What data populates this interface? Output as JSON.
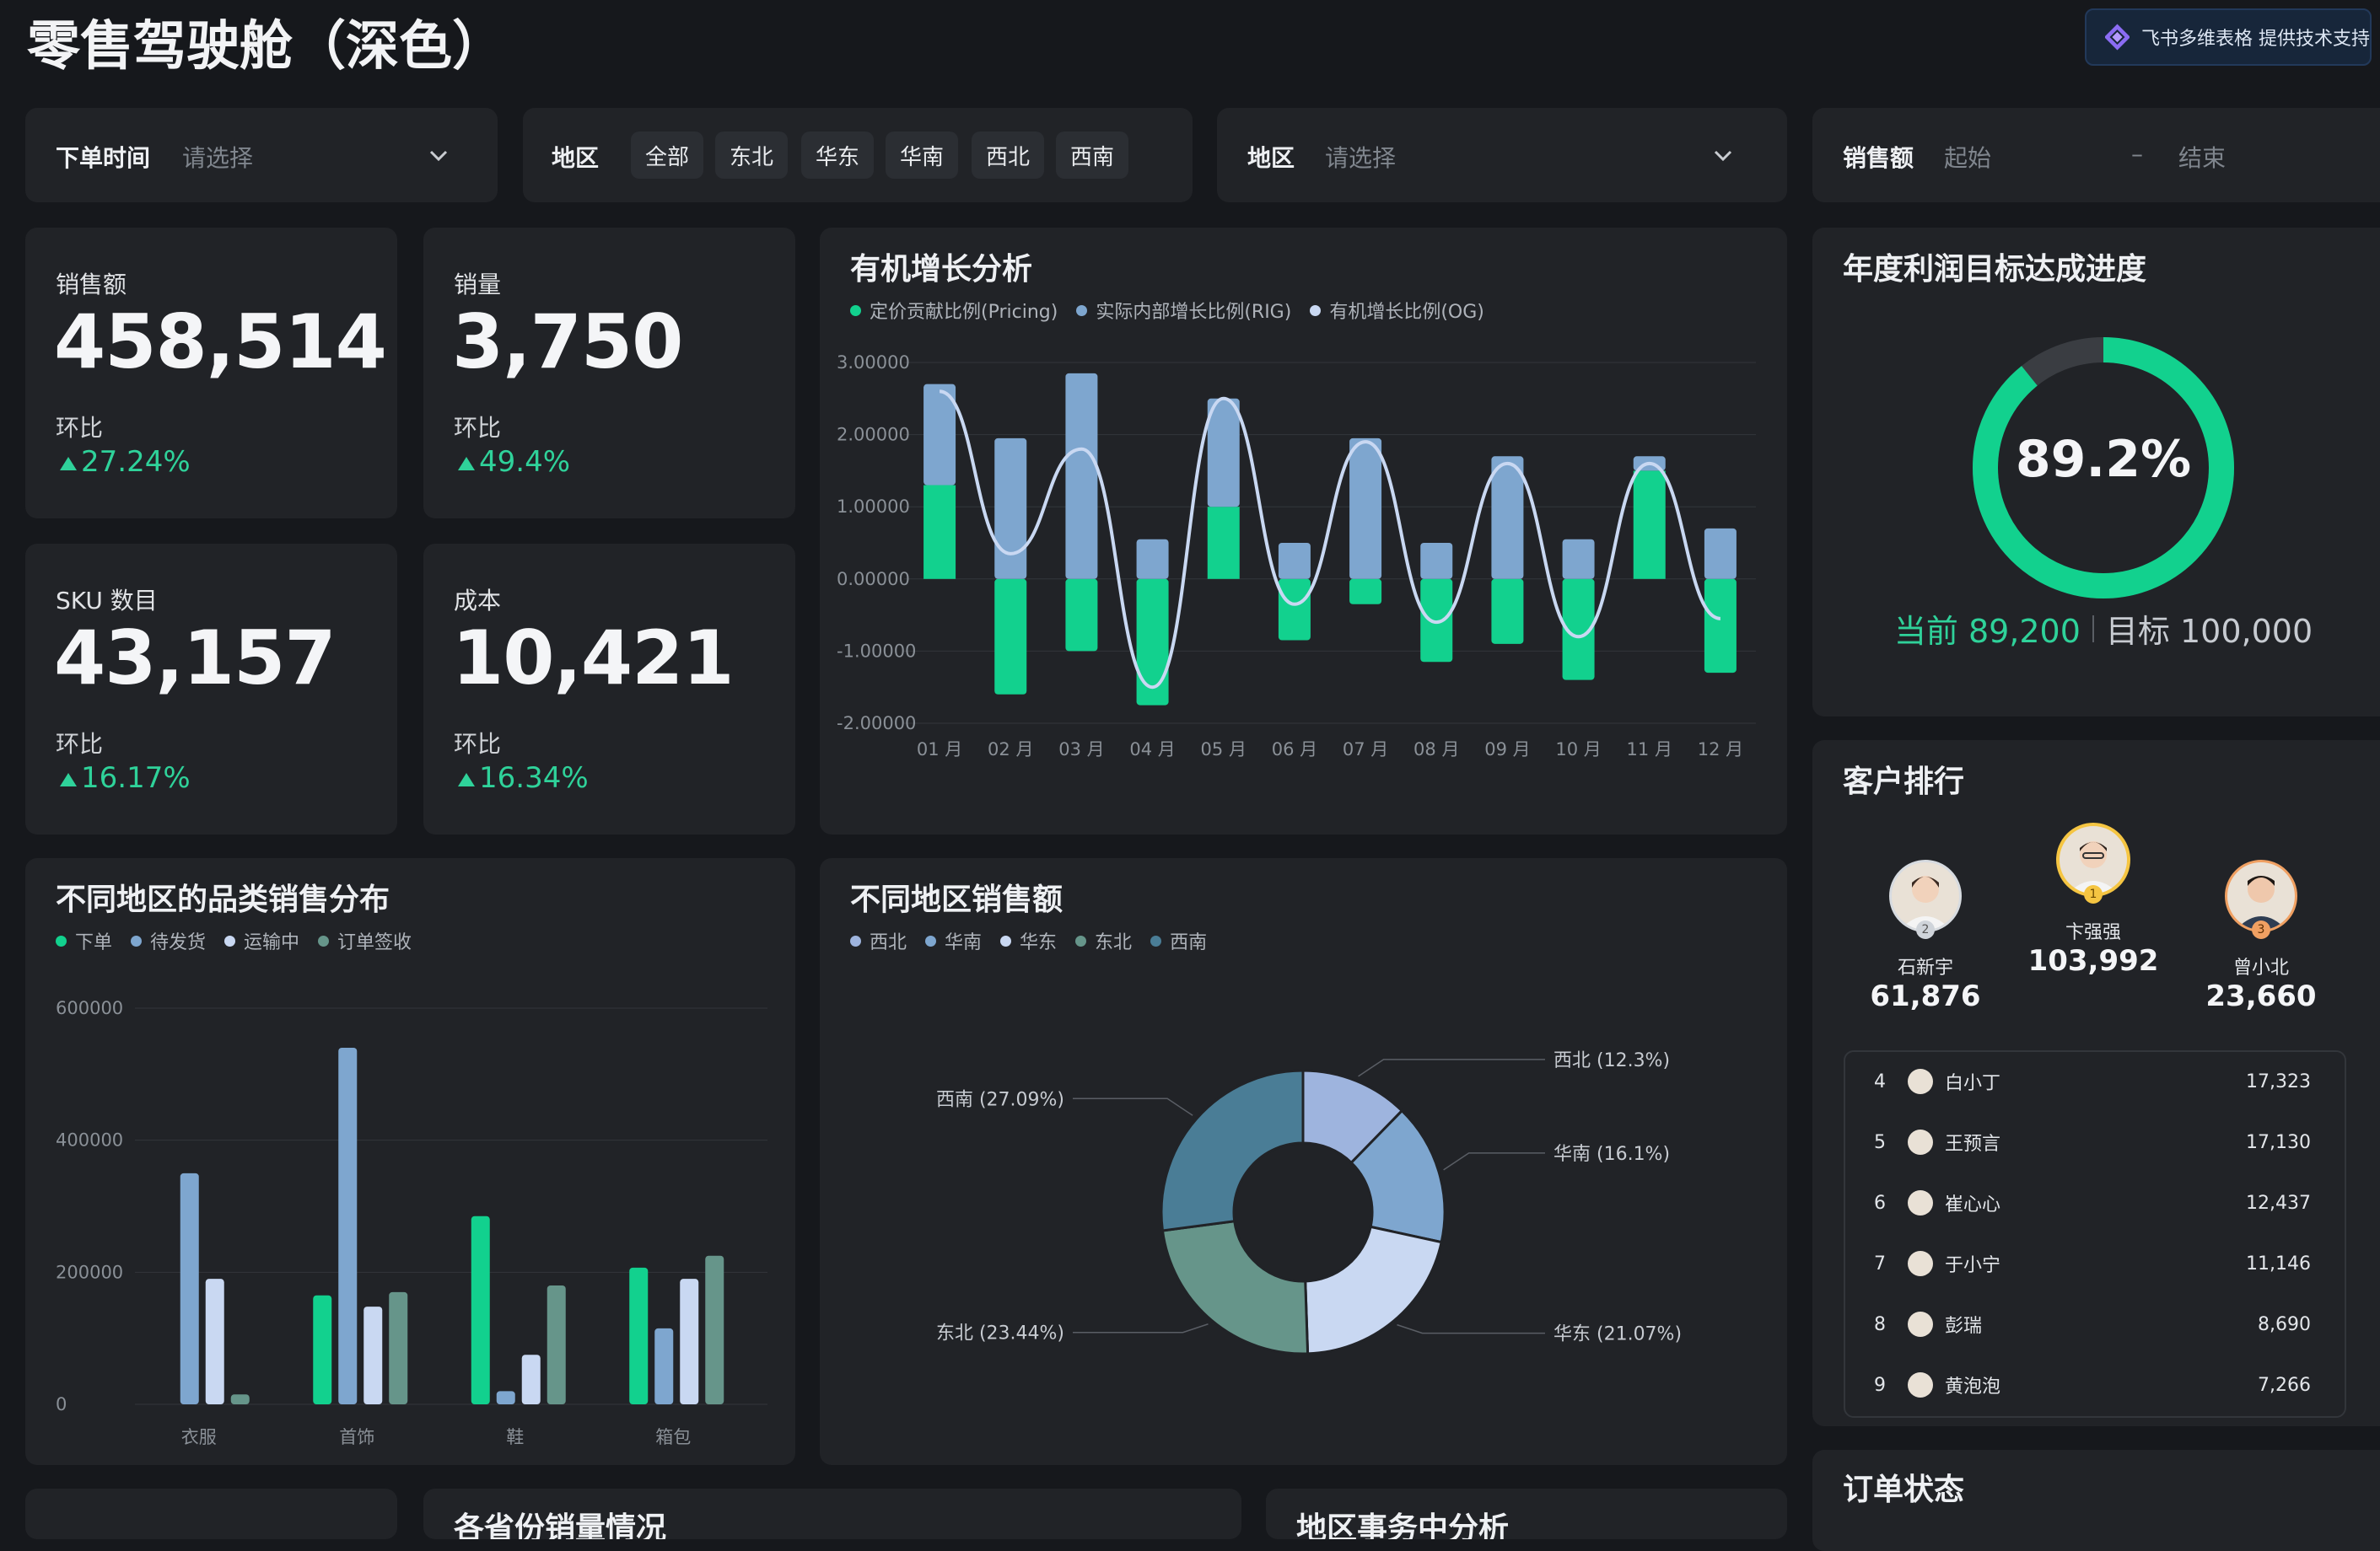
{
  "header": {
    "title": "零售驾驶舱（深色）",
    "brand": "飞书多维表格 提供技术支持"
  },
  "filters": {
    "order_time": {
      "label": "下单时间",
      "placeholder": "请选择"
    },
    "region_chips": {
      "label": "地区",
      "options": [
        "全部",
        "东北",
        "华东",
        "华南",
        "西北",
        "西南"
      ]
    },
    "region_select": {
      "label": "地区",
      "placeholder": "请选择"
    },
    "sales_range": {
      "label": "销售额",
      "start": "起始",
      "sep": "–",
      "end": "结束"
    }
  },
  "kpis": [
    {
      "label": "销售额",
      "value": "458,514",
      "cmp": "环比",
      "pct": "27.24%"
    },
    {
      "label": "销量",
      "value": "3,750",
      "cmp": "环比",
      "pct": "49.4%"
    },
    {
      "label": "SKU 数目",
      "value": "43,157",
      "cmp": "环比",
      "pct": "16.17%"
    },
    {
      "label": "成本",
      "value": "10,421",
      "cmp": "环比",
      "pct": "16.34%"
    }
  ],
  "colors": {
    "green": "#12d18e",
    "blue": "#7ea6cf",
    "light": "#c9d8f2",
    "teal": "#66958a",
    "steel": "#4a7d96"
  },
  "chart_data": [
    {
      "type": "bar",
      "title": "有机增长分析",
      "legend": [
        "定价贡献比例(Pricing)",
        "实际内部增长比例(RIG)",
        "有机增长比例(OG)"
      ],
      "categories": [
        "01 月",
        "02 月",
        "03 月",
        "04 月",
        "05 月",
        "06 月",
        "07 月",
        "08 月",
        "09 月",
        "10 月",
        "11 月",
        "12 月"
      ],
      "yticks": [
        "3.00000",
        "2.00000",
        "1.00000",
        "0.00000",
        "-1.00000",
        "-2.00000"
      ],
      "ylim": [
        -2,
        3
      ],
      "series": [
        {
          "name": "定价贡献比例(Pricing)",
          "values": [
            1.3,
            -1.6,
            -1.0,
            -1.75,
            1.0,
            -0.85,
            -0.35,
            -1.15,
            -0.9,
            -1.4,
            1.5,
            -1.3
          ]
        },
        {
          "name": "实际内部增长比例(RIG)",
          "values": [
            1.4,
            1.95,
            2.85,
            0.55,
            1.5,
            0.5,
            1.95,
            0.5,
            1.7,
            0.55,
            0.2,
            0.7
          ]
        },
        {
          "name": "有机增长比例(OG)",
          "values": [
            2.6,
            0.35,
            1.8,
            -1.5,
            2.5,
            -0.35,
            1.9,
            -0.6,
            1.6,
            -0.8,
            1.6,
            -0.55
          ]
        }
      ]
    },
    {
      "type": "bar",
      "title": "不同地区的品类销售分布",
      "legend": [
        "下单",
        "待发货",
        "运输中",
        "订单签收"
      ],
      "categories": [
        "衣服",
        "首饰",
        "鞋",
        "箱包"
      ],
      "yticks": [
        "600000",
        "400000",
        "200000",
        "0"
      ],
      "ylim": [
        0,
        600000
      ],
      "series": [
        {
          "name": "下单",
          "values": [
            0,
            165000,
            285000,
            207000
          ]
        },
        {
          "name": "待发货",
          "values": [
            350000,
            540000,
            20000,
            115000
          ]
        },
        {
          "name": "运输中",
          "values": [
            190000,
            148000,
            75000,
            190000
          ]
        },
        {
          "name": "订单签收",
          "values": [
            15000,
            170000,
            180000,
            225000
          ]
        }
      ]
    },
    {
      "type": "pie",
      "title": "不同地区销售额",
      "legend": [
        "西北",
        "华南",
        "华东",
        "东北",
        "西南"
      ],
      "slices": [
        {
          "name": "西北",
          "value": 12.3,
          "label": "西北 (12.3%)"
        },
        {
          "name": "华南",
          "value": 16.1,
          "label": "华南 (16.1%)"
        },
        {
          "name": "华东",
          "value": 21.07,
          "label": "华东 (21.07%)"
        },
        {
          "name": "东北",
          "value": 23.44,
          "label": "东北 (23.44%)"
        },
        {
          "name": "西南",
          "value": 27.09,
          "label": "西南 (27.09%)"
        }
      ]
    }
  ],
  "profit": {
    "title": "年度利润目标达成进度",
    "percent_text": "89.2%",
    "progress": 0.892,
    "current": "当前 89,200",
    "target": "目标 100,000"
  },
  "ranking": {
    "title": "客户排行",
    "top": [
      {
        "rank": "2",
        "name": "石新宇",
        "value": "61,876"
      },
      {
        "rank": "1",
        "name": "卞强强",
        "value": "103,992"
      },
      {
        "rank": "3",
        "name": "曾小北",
        "value": "23,660"
      }
    ],
    "rows": [
      {
        "rank": "4",
        "name": "白小丁",
        "value": "17,323"
      },
      {
        "rank": "5",
        "name": "王预言",
        "value": "17,130"
      },
      {
        "rank": "6",
        "name": "崔心心",
        "value": "12,437"
      },
      {
        "rank": "7",
        "name": "于小宁",
        "value": "11,146"
      },
      {
        "rank": "8",
        "name": "彭瑞",
        "value": "8,690"
      },
      {
        "rank": "9",
        "name": "黄泡泡",
        "value": "7,266"
      }
    ]
  },
  "bottom": {
    "order_status": "订单状态",
    "partial1": "各省份销量情况",
    "partial2": "地区事务中分析"
  }
}
